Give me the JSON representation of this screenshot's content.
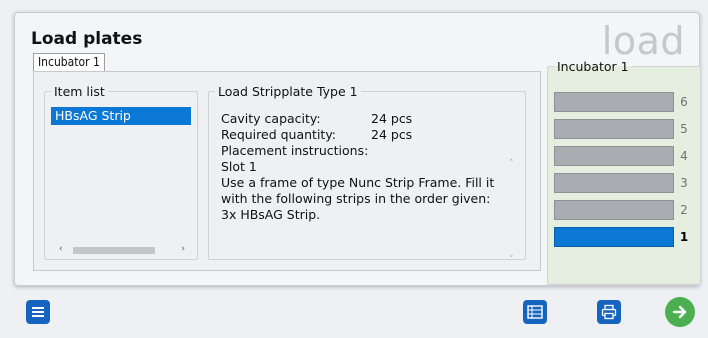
{
  "header": {
    "title": "Load plates",
    "watermark": "load"
  },
  "tab": {
    "label": "Incubator 1"
  },
  "item_list": {
    "legend": "Item list",
    "items": [
      {
        "label": "HBsAG Strip",
        "selected": true
      }
    ]
  },
  "load": {
    "legend": "Load Stripplate Type 1",
    "cavity_capacity_label": "Cavity capacity:",
    "cavity_capacity_value": "24 pcs",
    "required_quantity_label": "Required quantity:",
    "required_quantity_value": "24 pcs",
    "placement_label": "Placement instructions:",
    "slot_line": "Slot 1",
    "instruction_line1": "Use a frame of type Nunc Strip Frame. Fill it",
    "instruction_line2": "with the following strips in the order given:",
    "instruction_line3": "3x HBsAG Strip."
  },
  "incubator": {
    "legend": "Incubator 1",
    "slots": [
      {
        "number": "6",
        "active": false
      },
      {
        "number": "5",
        "active": false
      },
      {
        "number": "4",
        "active": false
      },
      {
        "number": "3",
        "active": false
      },
      {
        "number": "2",
        "active": false
      },
      {
        "number": "1",
        "active": true
      }
    ]
  },
  "icons": {
    "menu": "hamburger-menu-icon",
    "table": "table-view-icon",
    "print": "print-icon",
    "next": "arrow-right-circle-icon"
  },
  "colors": {
    "accent": "#0a78d4",
    "next": "#4caf50",
    "incubator_bg": "#e5efe0"
  }
}
